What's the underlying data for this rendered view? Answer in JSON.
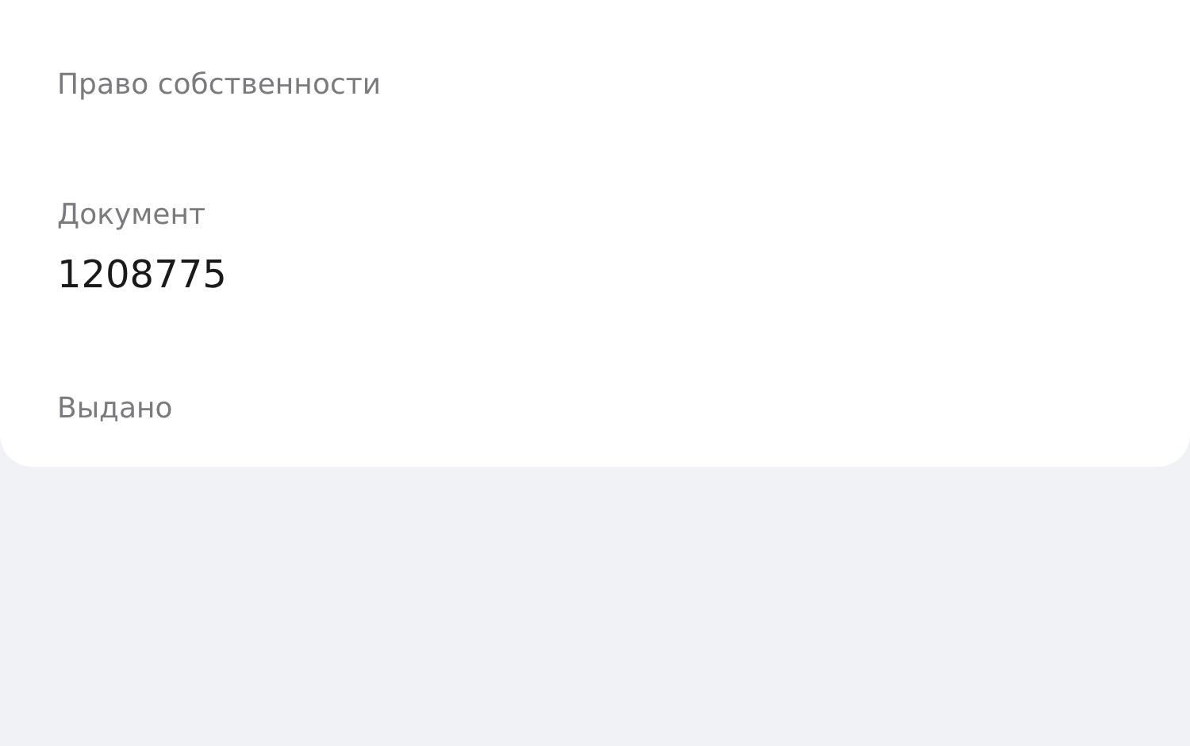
{
  "fields": [
    {
      "label": "Право собственности"
    },
    {
      "label": "Документ",
      "value": "1208775"
    },
    {
      "label": "Выдано"
    }
  ]
}
